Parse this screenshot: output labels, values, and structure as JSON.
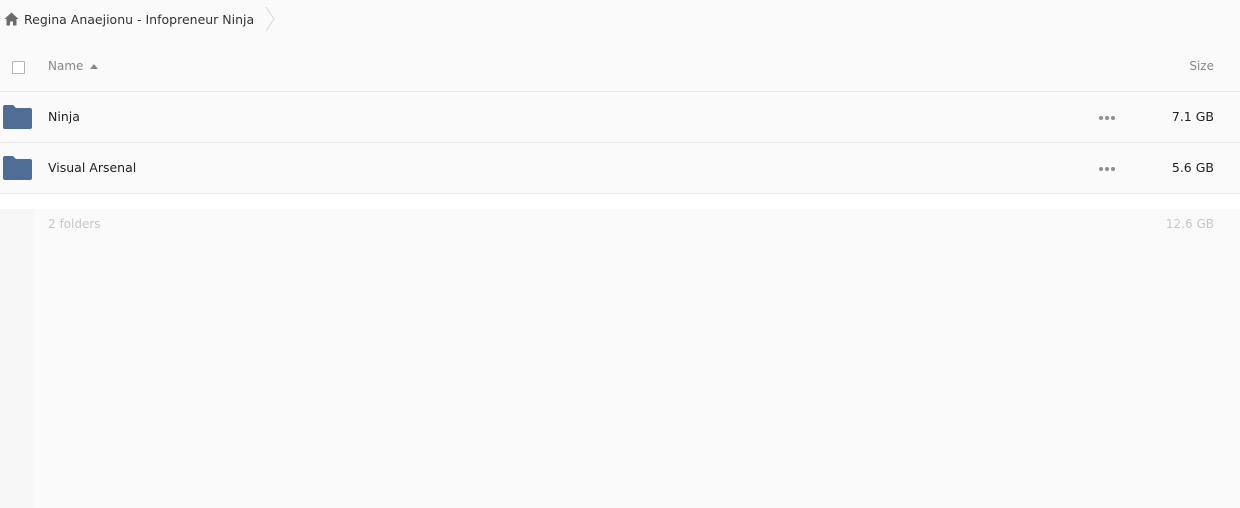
{
  "breadcrumb": {
    "home_icon": "home-icon",
    "label": "Regina Anaejionu - Infopreneur Ninja",
    "separator_icon": "chevron-right-icon"
  },
  "header": {
    "name_label": "Name",
    "sort_icon": "sort-ascending-icon",
    "size_label": "Size"
  },
  "rows": [
    {
      "icon": "folder-icon",
      "name": "Ninja",
      "size": "7.1 GB",
      "menu_icon": "more-icon"
    },
    {
      "icon": "folder-icon",
      "name": "Visual Arsenal",
      "size": "5.6 GB",
      "menu_icon": "more-icon"
    }
  ],
  "footer": {
    "summary": "2 folders",
    "total_size": "12.6 GB"
  },
  "colors": {
    "folder": "#4f6d95",
    "background": "#fafafa",
    "divider": "#e8e8e8",
    "muted_text": "#c8c8c8"
  }
}
